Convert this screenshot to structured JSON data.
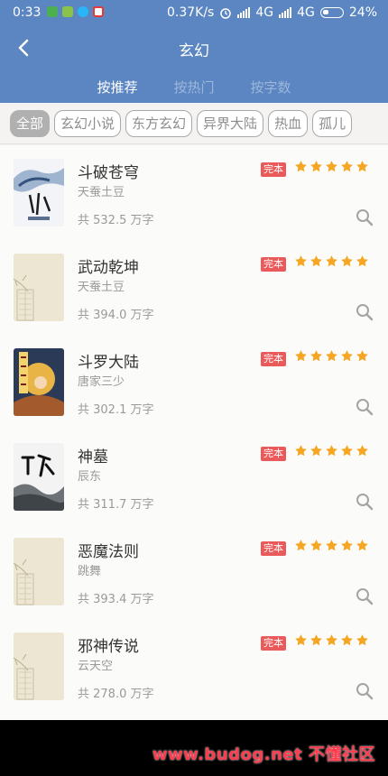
{
  "status": {
    "time": "0:33",
    "speed": "0.37K/s",
    "net1": "4G",
    "net2": "4G",
    "battery": "24%"
  },
  "header": {
    "title": "玄幻",
    "tabs": [
      {
        "label": "按推荐",
        "active": true
      },
      {
        "label": "按热门",
        "active": false
      },
      {
        "label": "按字数",
        "active": false
      }
    ]
  },
  "categories": [
    {
      "label": "全部",
      "active": true
    },
    {
      "label": "玄幻小说",
      "active": false
    },
    {
      "label": "东方玄幻",
      "active": false
    },
    {
      "label": "异界大陆",
      "active": false
    },
    {
      "label": "热血",
      "active": false
    },
    {
      "label": "孤儿",
      "active": false
    }
  ],
  "books": [
    {
      "title": "斗破苍穹",
      "author": "天蚕土豆",
      "words": "共 532.5 万字",
      "status": "完本",
      "rating": 5,
      "cover": "art1"
    },
    {
      "title": "武动乾坤",
      "author": "天蚕土豆",
      "words": "共 394.0 万字",
      "status": "完本",
      "rating": 5,
      "cover": "placeholder"
    },
    {
      "title": "斗罗大陆",
      "author": "唐家三少",
      "words": "共 302.1 万字",
      "status": "完本",
      "rating": 5,
      "cover": "art2"
    },
    {
      "title": "神墓",
      "author": "辰东",
      "words": "共 311.7 万字",
      "status": "完本",
      "rating": 5,
      "cover": "art3"
    },
    {
      "title": "恶魔法则",
      "author": "跳舞",
      "words": "共 393.4 万字",
      "status": "完本",
      "rating": 5,
      "cover": "placeholder"
    },
    {
      "title": "邪神传说",
      "author": "云天空",
      "words": "共 278.0 万字",
      "status": "完本",
      "rating": 5,
      "cover": "placeholder"
    }
  ],
  "watermark": "www.budog.net 不懂社区",
  "colors": {
    "header": "#5b86c1",
    "star": "#f5a623",
    "badge": "#ea5a5a"
  }
}
